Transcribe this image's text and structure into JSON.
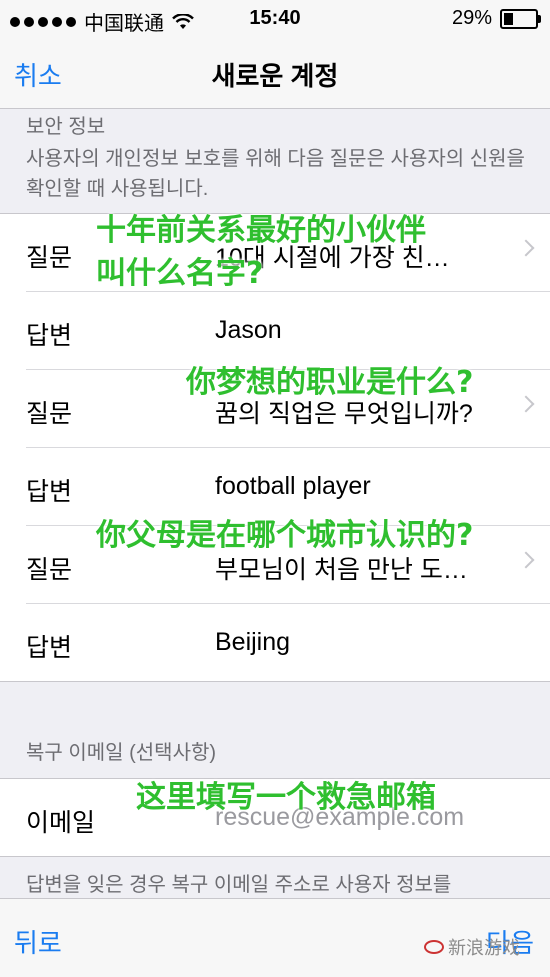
{
  "status_bar": {
    "carrier": "中国联通",
    "time": "15:40",
    "battery_percent": "29%",
    "battery_level": 0.29
  },
  "nav": {
    "cancel": "취소",
    "title": "새로운 계정"
  },
  "security": {
    "header": "보안 정보",
    "description": "사용자의 개인정보 보호를 위해 다음 질문은 사용자의 신원을 확인할 때 사용됩니다.",
    "rows": [
      {
        "label": "질문",
        "value": "10대 시절에 가장 친…"
      },
      {
        "label": "답변",
        "value": "Jason"
      },
      {
        "label": "질문",
        "value": "꿈의 직업은 무엇입니까?"
      },
      {
        "label": "답변",
        "value": "football player"
      },
      {
        "label": "질문",
        "value": "부모님이 처음 만난 도…"
      },
      {
        "label": "답변",
        "value": "Beijing"
      }
    ]
  },
  "recovery": {
    "header": "복구 이메일 (선택사항)",
    "label": "이메일",
    "placeholder": "rescue@example.com",
    "footer": "답변을 잊은 경우 복구 이메일 주소로 사용자 정보를"
  },
  "toolbar": {
    "back": "뒤로",
    "next": "다음"
  },
  "annotations": {
    "a1_line1": "十年前关系最好的小伙伴",
    "a1_line2": "叫什么名字?",
    "a2": "你梦想的职业是什么?",
    "a3": "你父母是在哪个城市认识的?",
    "a4": "这里填写一个救急邮箱"
  },
  "watermark": "新浪游戏",
  "colors": {
    "ios_blue": "#1a7cf0",
    "annotation_green": "#2fbf2f"
  }
}
